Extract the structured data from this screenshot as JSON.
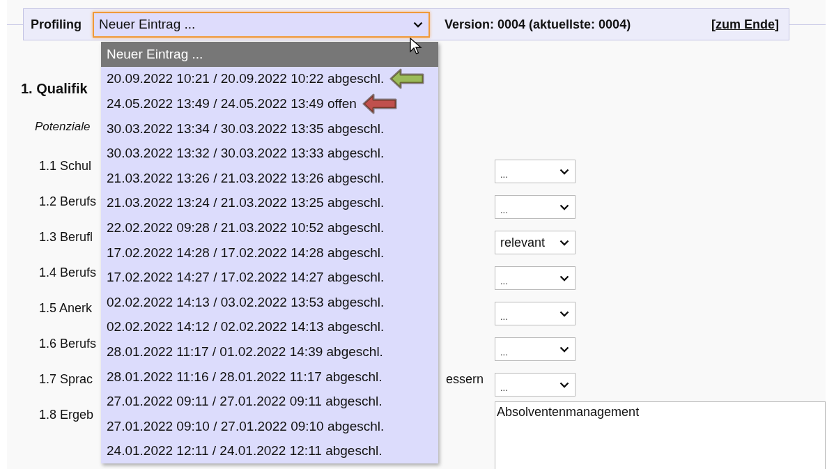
{
  "header": {
    "title": "Profiling",
    "select": {
      "value": "Neuer Eintrag ...",
      "focused": true
    },
    "version": "Version: 0004 (aktuellste: 0004)",
    "link": {
      "open": "[",
      "label": "zum Ende",
      "close": "]"
    }
  },
  "dropdown": {
    "options": [
      {
        "label": "Neuer Eintrag ...",
        "selected": true
      },
      {
        "label": "20.09.2022 10:21 / 20.09.2022 10:22 abgeschl.",
        "selected": false,
        "marker": {
          "color": "#9bbb59"
        }
      },
      {
        "label": "24.05.2022 13:49 / 24.05.2022 13:49 offen",
        "selected": false,
        "marker": {
          "color": "#c0504d"
        }
      },
      {
        "label": "30.03.2022 13:34 / 30.03.2022 13:35 abgeschl.",
        "selected": false
      },
      {
        "label": "30.03.2022 13:32 / 30.03.2022 13:33 abgeschl.",
        "selected": false
      },
      {
        "label": "21.03.2022 13:26 / 21.03.2022 13:26 abgeschl.",
        "selected": false
      },
      {
        "label": "21.03.2022 13:24 / 21.03.2022 13:25 abgeschl.",
        "selected": false
      },
      {
        "label": "22.02.2022 09:28 / 21.03.2022 10:52 abgeschl.",
        "selected": false
      },
      {
        "label": "17.02.2022 14:28 / 17.02.2022 14:28 abgeschl.",
        "selected": false
      },
      {
        "label": "17.02.2022 14:27 / 17.02.2022 14:27 abgeschl.",
        "selected": false
      },
      {
        "label": "02.02.2022 14:13 / 03.02.2022 13:53 abgeschl.",
        "selected": false
      },
      {
        "label": "02.02.2022 14:12 / 02.02.2022 14:13 abgeschl.",
        "selected": false
      },
      {
        "label": "28.01.2022 11:17 / 01.02.2022 14:39 abgeschl.",
        "selected": false
      },
      {
        "label": "28.01.2022 11:16 / 28.01.2022 11:17 abgeschl.",
        "selected": false
      },
      {
        "label": "27.01.2022 09:11 / 27.01.2022 09:11 abgeschl.",
        "selected": false
      },
      {
        "label": "27.01.2022 09:10 / 27.01.2022 09:10 abgeschl.",
        "selected": false
      },
      {
        "label": "24.01.2022 12:11 / 24.01.2022 12:11 abgeschl.",
        "selected": false
      }
    ]
  },
  "section": {
    "heading": "1. Qualifik",
    "subheading": "Potenziale",
    "rows": [
      {
        "label": "1.1 Schul",
        "kind": "select",
        "value": "..."
      },
      {
        "label": "1.2 Berufs",
        "kind": "select",
        "value": "..."
      },
      {
        "label": "1.3 Berufl",
        "kind": "select",
        "value": "relevant"
      },
      {
        "label": "1.4 Berufs",
        "kind": "select",
        "value": "..."
      },
      {
        "label": "1.5 Anerk",
        "kind": "select",
        "value": "..."
      },
      {
        "label": "1.6 Berufs",
        "kind": "select",
        "value": "..."
      },
      {
        "label": "1.7 Sprac",
        "label_end": "essern",
        "kind": "select",
        "value": "..."
      },
      {
        "label": "1.8 Ergeb",
        "kind": "textarea",
        "value": "Absolventenmanagement"
      }
    ]
  }
}
